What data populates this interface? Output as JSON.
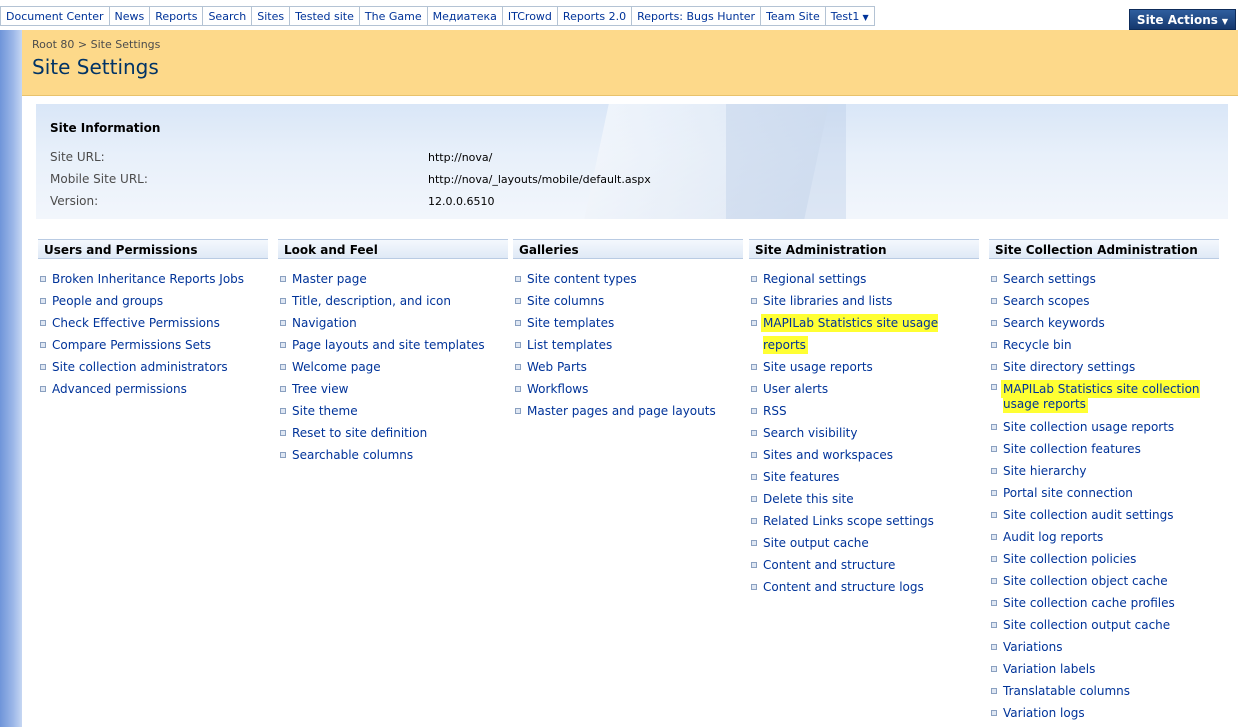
{
  "topnav": {
    "tabs": [
      "Document Center",
      "News",
      "Reports",
      "Search",
      "Sites",
      "Tested site",
      "The Game",
      "Медиатека",
      "ITCrowd",
      "Reports 2.0",
      "Reports: Bugs Hunter",
      "Team Site",
      "Test1"
    ],
    "site_actions": "Site Actions"
  },
  "header": {
    "breadcrumb_root": "Root 80",
    "breadcrumb_sep": ">",
    "breadcrumb_current": "Site Settings",
    "title": "Site Settings"
  },
  "site_info": {
    "heading": "Site Information",
    "rows": [
      {
        "label": "Site URL:",
        "value": "http://nova/"
      },
      {
        "label": "Mobile Site URL:",
        "value": "http://nova/_layouts/mobile/default.aspx"
      },
      {
        "label": "Version:",
        "value": "12.0.0.6510"
      }
    ]
  },
  "columns": [
    {
      "heading": "Users and Permissions",
      "items": [
        "Broken Inheritance Reports Jobs",
        "People and groups",
        "Check Effective Permissions",
        "Compare Permissions Sets",
        "Site collection administrators",
        "Advanced permissions"
      ]
    },
    {
      "heading": "Look and Feel",
      "items": [
        "Master page",
        "Title, description, and icon",
        "Navigation",
        "Page layouts and site templates",
        "Welcome page",
        "Tree view",
        "Site theme",
        "Reset to site definition",
        "Searchable columns"
      ]
    },
    {
      "heading": "Galleries",
      "items": [
        "Site content types",
        "Site columns",
        "Site templates",
        "List templates",
        "Web Parts",
        "Workflows",
        "Master pages and page layouts"
      ]
    },
    {
      "heading": "Site Administration",
      "items": [
        "Regional settings",
        "Site libraries and lists",
        "MAPILab Statistics site usage reports",
        "Site usage reports",
        "User alerts",
        "RSS",
        "Search visibility",
        "Sites and workspaces",
        "Site features",
        "Delete this site",
        "Related Links scope settings",
        "Site output cache",
        "Content and structure",
        "Content and structure logs"
      ]
    },
    {
      "heading": "Site Collection Administration",
      "items": [
        "Search settings",
        "Search scopes",
        "Search keywords",
        "Recycle bin",
        "Site directory settings",
        "MAPILab Statistics site collection usage reports",
        "Site collection usage reports",
        "Site collection features",
        "Site hierarchy",
        "Portal site connection",
        "Site collection audit settings",
        "Audit log reports",
        "Site collection policies",
        "Site collection object cache",
        "Site collection cache profiles",
        "Site collection output cache",
        "Variations",
        "Variation labels",
        "Translatable columns",
        "Variation logs"
      ]
    }
  ],
  "highlight_color": "#ffff33"
}
